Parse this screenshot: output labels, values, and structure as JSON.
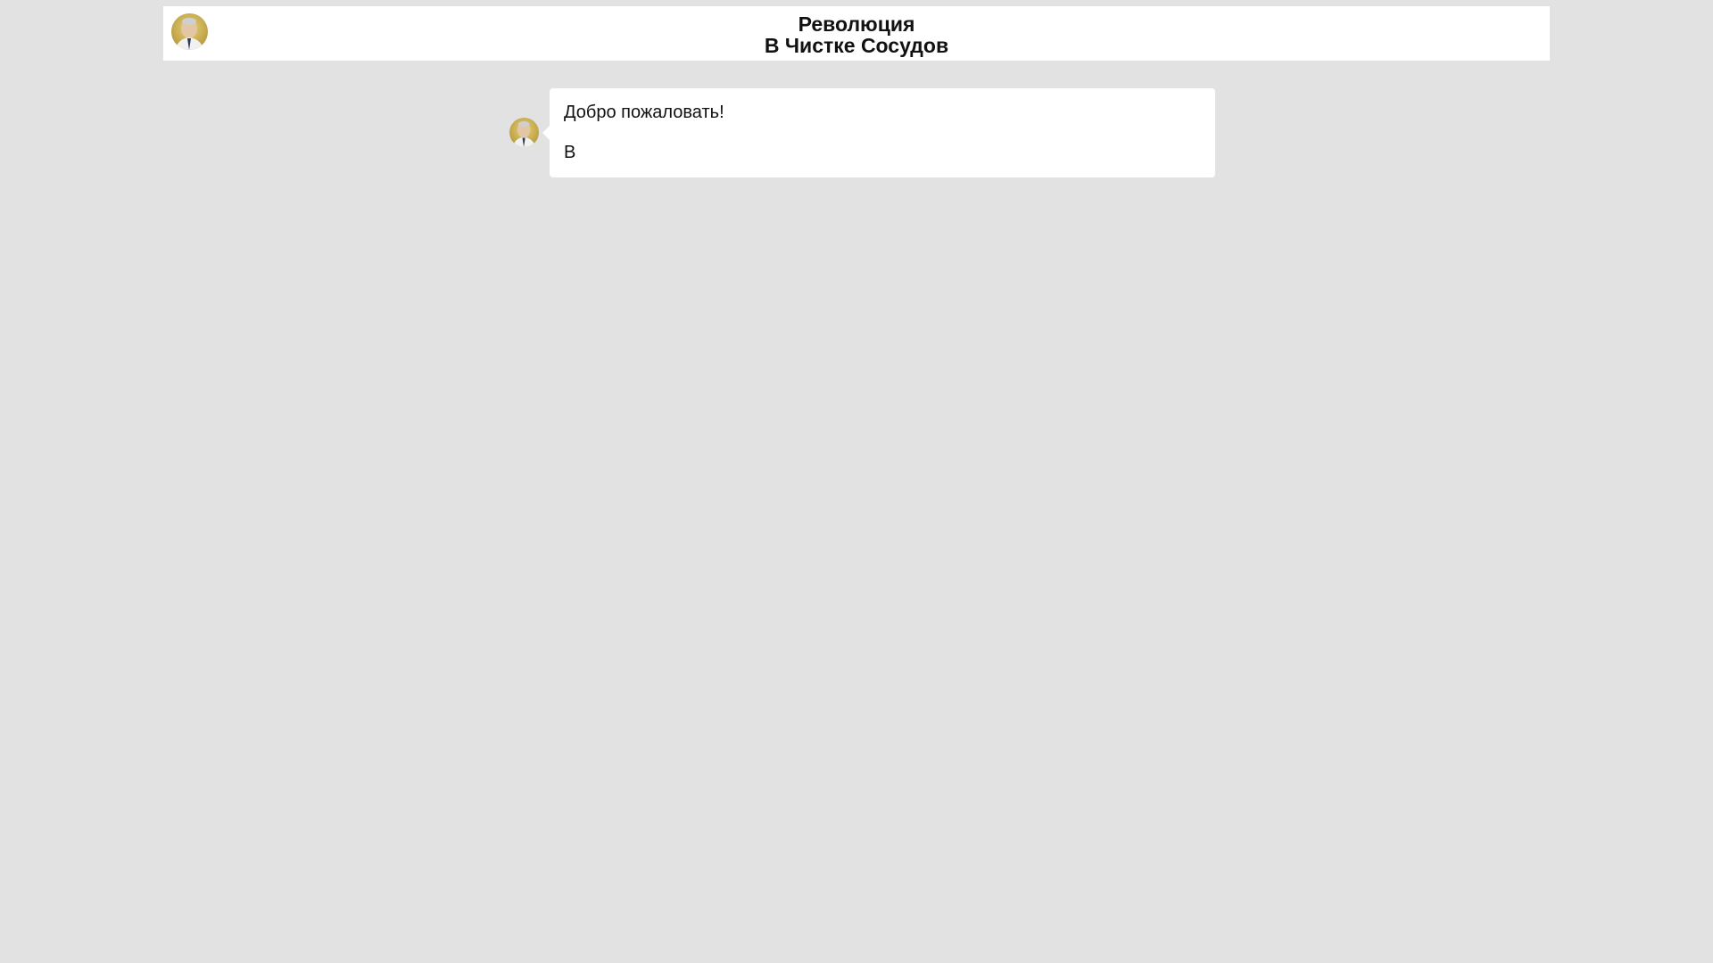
{
  "header": {
    "title_line1": "Революция",
    "title_line2": "В Чистке Сосудов",
    "avatar_icon": "person-photo-icon"
  },
  "chat": {
    "messages": [
      {
        "avatar_icon": "person-photo-icon",
        "lines": [
          "Добро пожаловать!",
          "В"
        ]
      }
    ]
  },
  "colors": {
    "background": "#e2e2e2",
    "panel": "#ffffff"
  }
}
